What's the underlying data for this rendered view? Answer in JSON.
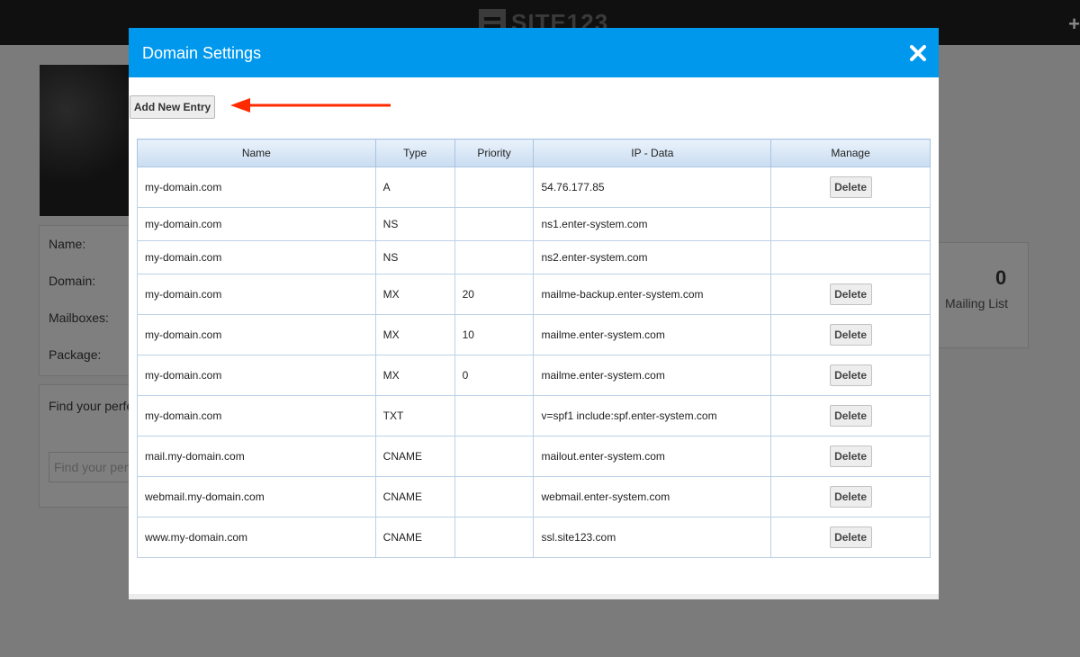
{
  "background": {
    "logo_text": "SITE123",
    "labels": [
      "Name:",
      "Domain:",
      "Mailboxes:",
      "Package:"
    ],
    "find_text": "Find your perfe",
    "find_placeholder": "Find your perf",
    "stat_value": "0",
    "stat_label": "Mailing List"
  },
  "modal": {
    "title": "Domain Settings",
    "add_button": "Add New Entry",
    "accent_color": "#0098ed",
    "arrow_color": "#ff2a00"
  },
  "table": {
    "headers": [
      "Name",
      "Type",
      "Priority",
      "IP - Data",
      "Manage"
    ],
    "delete_label": "Delete",
    "rows": [
      {
        "name": "my-domain.com",
        "type": "A",
        "priority": "",
        "data": "54.76.177.85",
        "deletable": true
      },
      {
        "name": "my-domain.com",
        "type": "NS",
        "priority": "",
        "data": "ns1.enter-system.com",
        "deletable": false
      },
      {
        "name": "my-domain.com",
        "type": "NS",
        "priority": "",
        "data": "ns2.enter-system.com",
        "deletable": false
      },
      {
        "name": "my-domain.com",
        "type": "MX",
        "priority": "20",
        "data": "mailme-backup.enter-system.com",
        "deletable": true
      },
      {
        "name": "my-domain.com",
        "type": "MX",
        "priority": "10",
        "data": "mailme.enter-system.com",
        "deletable": true
      },
      {
        "name": "my-domain.com",
        "type": "MX",
        "priority": "0",
        "data": "mailme.enter-system.com",
        "deletable": true
      },
      {
        "name": "my-domain.com",
        "type": "TXT",
        "priority": "",
        "data": "v=spf1 include:spf.enter-system.com",
        "deletable": true
      },
      {
        "name": "mail.my-domain.com",
        "type": "CNAME",
        "priority": "",
        "data": "mailout.enter-system.com",
        "deletable": true
      },
      {
        "name": "webmail.my-domain.com",
        "type": "CNAME",
        "priority": "",
        "data": "webmail.enter-system.com",
        "deletable": true
      },
      {
        "name": "www.my-domain.com",
        "type": "CNAME",
        "priority": "",
        "data": "ssl.site123.com",
        "deletable": true
      }
    ]
  }
}
